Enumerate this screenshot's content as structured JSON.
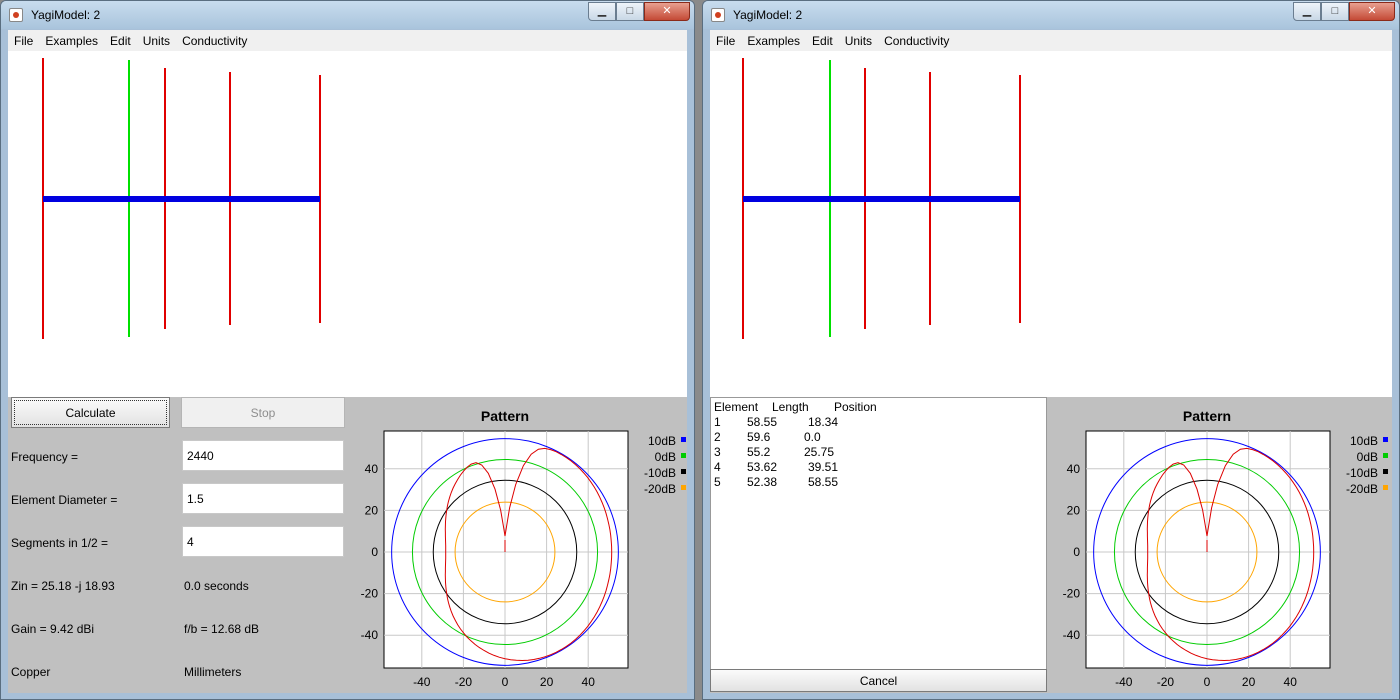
{
  "windows": [
    {
      "title": "YagiModel: 2",
      "menu": [
        "File",
        "Examples",
        "Edit",
        "Units",
        "Conductivity"
      ],
      "calculate_label": "Calculate",
      "stop_label": "Stop",
      "frequency_label": "Frequency =",
      "frequency_value": "2440",
      "diameter_label": "Element Diameter =",
      "diameter_value": "1.5",
      "segments_label": "Segments in 1/2 =",
      "segments_value": "4",
      "zin": "Zin = 25.18 -j 18.93",
      "time": "0.0 seconds",
      "gain": "Gain = 9.42 dBi",
      "fb": "f/b = 12.68 dB",
      "conductor": "Copper",
      "units": "Millimeters"
    },
    {
      "title": "YagiModel: 2",
      "menu": [
        "File",
        "Examples",
        "Edit",
        "Units",
        "Conductivity"
      ],
      "table_header": {
        "element": "Element",
        "length": "Length",
        "position": "Position"
      },
      "table_rows": [
        {
          "element": "1",
          "length": "58.55",
          "position": "18.34"
        },
        {
          "element": "2",
          "length": "59.6",
          "position": "0.0"
        },
        {
          "element": "3",
          "length": "55.2",
          "position": "25.75"
        },
        {
          "element": "4",
          "length": "53.62",
          "position": "39.51"
        },
        {
          "element": "5",
          "length": "52.38",
          "position": "58.55"
        }
      ],
      "cancel_label": "Cancel"
    }
  ],
  "pattern": {
    "title": "Pattern",
    "x_ticks": [
      "-40",
      "-20",
      "0",
      "20",
      "40"
    ],
    "y_ticks": [
      "40",
      "20",
      "0",
      "-20",
      "-40"
    ],
    "legend": [
      {
        "label": "10dB",
        "color": "#0000ff"
      },
      {
        "label": "0dB",
        "color": "#00cc00"
      },
      {
        "label": "-10dB",
        "color": "#000000"
      },
      {
        "label": "-20dB",
        "color": "#ffa500"
      }
    ],
    "trace_color": "#dd0000"
  },
  "antenna": {
    "boom_color": "#0000e0",
    "driven_color": "#00e000",
    "element_color": "#e00000"
  }
}
